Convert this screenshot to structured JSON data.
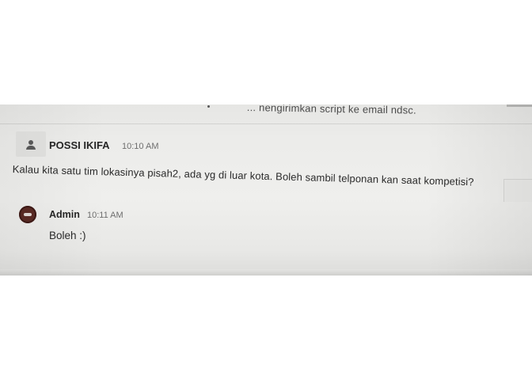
{
  "previous_message": {
    "text": "... nengirimkan script ke email ndsc."
  },
  "messages": [
    {
      "sender": "POSSI IKIFA",
      "time": "10:10 AM",
      "text": "Kalau kita satu tim lokasinya pisah2, ada yg di luar kota. Boleh sambil telponan kan saat kompetisi?"
    },
    {
      "sender": "Admin",
      "time": "10:11 AM",
      "text": "Boleh :)"
    }
  ],
  "icons": {
    "user_avatar": "person-placeholder-icon",
    "admin_avatar": "admin-avatar-icon"
  },
  "colors": {
    "background": "#ececea",
    "text": "#2a2a2a",
    "timestamp": "#6e6e6e",
    "admin_avatar": "#5a2a24"
  }
}
